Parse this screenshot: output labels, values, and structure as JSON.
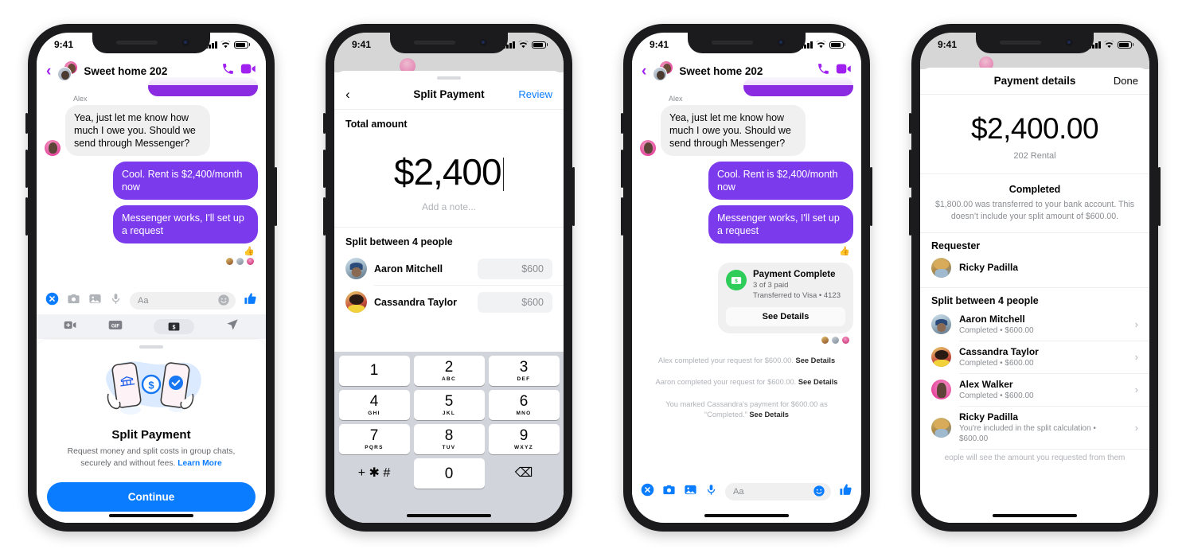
{
  "status_bar": {
    "time": "9:41"
  },
  "phone1": {
    "chat": {
      "title": "Sweet home 202",
      "sender_label": "Alex",
      "incoming": "Yea, just let me know how much I owe you. Should we send through Messenger?",
      "outgoing_1": "Cool. Rent is $2,400/month now",
      "outgoing_2": "Messenger works, I'll set up a request",
      "composer_placeholder": "Aa"
    },
    "intro": {
      "title": "Split Payment",
      "description_1": "Request money and split costs in group chats, securely and without fees. ",
      "learn_more": "Learn More",
      "cta": "Continue"
    }
  },
  "phone2": {
    "header": {
      "title": "Split Payment",
      "action": "Review",
      "back": "‹"
    },
    "total_label": "Total amount",
    "amount": "$2,400",
    "note_placeholder": "Add a note...",
    "split_label": "Split between 4 people",
    "people": [
      {
        "name": "Aaron Mitchell",
        "amount": "$600",
        "avatar": "aaron"
      },
      {
        "name": "Cassandra Taylor",
        "amount": "$600",
        "avatar": "cass"
      }
    ],
    "keypad": [
      {
        "num": "1",
        "abc": ""
      },
      {
        "num": "2",
        "abc": "ABC"
      },
      {
        "num": "3",
        "abc": "DEF"
      },
      {
        "num": "4",
        "abc": "GHI"
      },
      {
        "num": "5",
        "abc": "JKL"
      },
      {
        "num": "6",
        "abc": "MNO"
      },
      {
        "num": "7",
        "abc": "PQRS"
      },
      {
        "num": "8",
        "abc": "TUV"
      },
      {
        "num": "9",
        "abc": "WXYZ"
      },
      {
        "num": "+ ✱ #",
        "abc": ""
      },
      {
        "num": "0",
        "abc": ""
      },
      {
        "num": "⌫",
        "abc": ""
      }
    ]
  },
  "phone3": {
    "chat": {
      "title": "Sweet home 202",
      "sender_label": "Alex",
      "incoming": "Yea, just let me know how much I owe you. Should we send through Messenger?",
      "outgoing_1": "Cool. Rent is $2,400/month now",
      "outgoing_2": "Messenger works, I'll set up a request",
      "composer_placeholder": "Aa"
    },
    "card": {
      "title": "Payment Complete",
      "line1": "3 of 3 paid",
      "line2": "Transferred to Visa • 4123",
      "button": "See Details"
    },
    "system_messages": [
      {
        "text": "Alex completed your request for $600.00. ",
        "link": "See Details"
      },
      {
        "text": "Aaron completed your request for $600.00. ",
        "link": "See Details"
      },
      {
        "text": "You marked Cassandra's payment for $600.00 as “Completed.” ",
        "link": "See Details"
      }
    ]
  },
  "phone4": {
    "header": {
      "title": "Payment details",
      "action": "Done"
    },
    "amount": "$2,400.00",
    "memo": "202 Rental",
    "status": "Completed",
    "description": "$1,800.00 was transferred to your bank account. This doesn’t include your split amount of $600.00.",
    "requester_label": "Requester",
    "requester": {
      "name": "Ricky Padilla",
      "avatar": "ricky"
    },
    "split_label": "Split between 4 people",
    "people": [
      {
        "name": "Aaron Mitchell",
        "sub": "Completed • $600.00",
        "avatar": "aaron"
      },
      {
        "name": "Cassandra Taylor",
        "sub": "Completed • $600.00",
        "avatar": "cass"
      },
      {
        "name": "Alex Walker",
        "sub": "Completed • $600.00",
        "avatar": "alex"
      },
      {
        "name": "Ricky Padilla",
        "sub": "You're included in the split calculation • $600.00",
        "avatar": "ricky"
      }
    ],
    "footer_note": "eople will see the amount you requested from them"
  },
  "colors": {
    "messenger_blue": "#0a7cff",
    "bubble_purple": "#7c3aed",
    "header_purple": "#a020f0",
    "success_green": "#2ecc58",
    "grey_bubble": "#f1f0f0"
  }
}
